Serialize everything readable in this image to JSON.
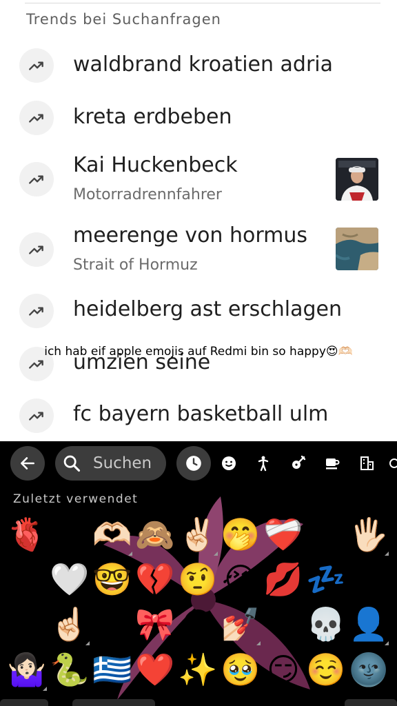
{
  "section_title": "Trends bei Suchanfragen",
  "suggestions": [
    {
      "title": "waldbrand kroatien adria",
      "subtitle": ""
    },
    {
      "title": "kreta erdbeben",
      "subtitle": ""
    },
    {
      "title": "Kai Huckenbeck",
      "subtitle": "Motorradrennfahrer"
    },
    {
      "title": "meerenge von hormus",
      "subtitle": "Strait of Hormuz"
    },
    {
      "title": "heidelberg ast erschlagen",
      "subtitle": ""
    },
    {
      "title": "umzien seine",
      "subtitle": ""
    },
    {
      "title": "fc bayern basketball ulm",
      "subtitle": ""
    }
  ],
  "caption": "ich hab eif apple emojis auf Redmi bin so happy😍🫶🏻",
  "keyboard": {
    "search_placeholder": "Suchen",
    "recent_label": "Zuletzt verwendet",
    "categories": [
      "recent-clock-icon",
      "smiley-icon",
      "person-icon",
      "activity-icon",
      "food-cup-icon",
      "building-icon"
    ],
    "emoji_rows": [
      [
        "🫀",
        "😌",
        "🫶🏻",
        "🙈",
        "✌🏻",
        "🤭",
        "❤️‍🩹",
        "😍",
        "🖐🏻"
      ],
      [
        "😔",
        "🤍",
        "🤓",
        "💔",
        "🤨",
        "😭",
        "💋",
        "💤",
        "😚"
      ],
      [
        "🙃",
        "☝🏻",
        "😣",
        "🎀",
        "😱",
        "💅🏻",
        "😈",
        "💀",
        "👤"
      ],
      [
        "🤷🏻‍♀️",
        "🐍",
        "🇬🇷",
        "❤️",
        "✨",
        "🥹",
        "😏",
        "☺️",
        "🌚"
      ]
    ]
  },
  "colors": {
    "keyboard_bg": "#000000",
    "key_bg": "#3c3c3c",
    "title_text": "#1f1f1f",
    "sub_text": "#6b6b6b"
  }
}
